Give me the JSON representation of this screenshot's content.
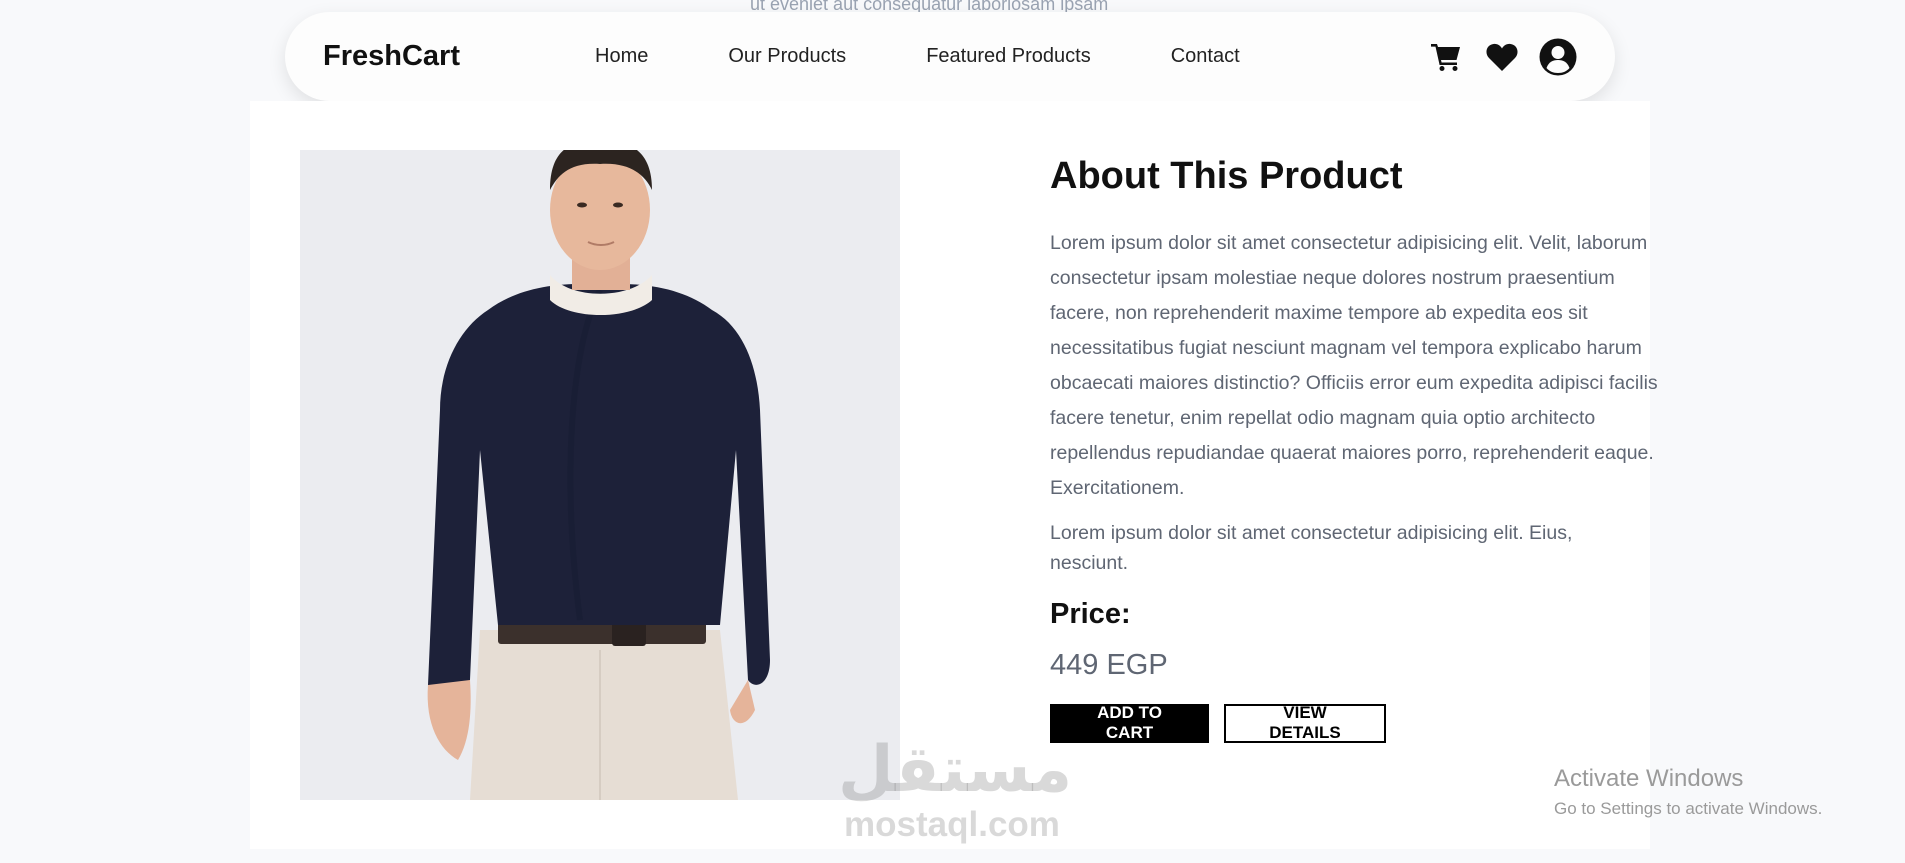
{
  "background_text": "ut eveniet aut consequatur laboriosam ipsam",
  "navbar": {
    "brand": "FreshCart",
    "links": [
      "Home",
      "Our Products",
      "Featured Products",
      "Contact"
    ],
    "icons": [
      "cart-icon",
      "heart-icon",
      "user-circle-icon"
    ]
  },
  "product": {
    "image_alt": "man-in-navy-sweater",
    "title": "About This Product",
    "description": "Lorem ipsum dolor sit amet consectetur adipisicing elit. Velit, laborum consectetur ipsam molestiae neque dolores nostrum praesentium facere, non reprehenderit maxime tempore ab expedita eos sit necessitatibus fugiat nesciunt magnam vel tempora explicabo harum obcaecati maiores distinctio? Officiis error eum expedita adipisci facilis facere tenetur, enim repellat odio magnam quia optio architecto repellendus repudiandae quaerat maiores porro, reprehenderit eaque. Exercitationem.",
    "description2": "Lorem ipsum dolor sit amet consectetur adipisicing elit. Eius, nesciunt.",
    "price_label": "Price:",
    "price_value": "449 EGP",
    "add_to_cart": "ADD TO CART",
    "view_details": "VIEW DETAILS"
  },
  "watermark": {
    "arabic": "مستقل",
    "latin": "mostaql.com"
  },
  "windows_activation": {
    "title": "Activate Windows",
    "subtitle": "Go to Settings to activate Windows."
  },
  "colors": {
    "accent": "#000000",
    "muted_text": "#5f6673",
    "page_bg": "#f8f9fb",
    "sweater": "#1d2139",
    "pants": "#e6ddd4"
  }
}
